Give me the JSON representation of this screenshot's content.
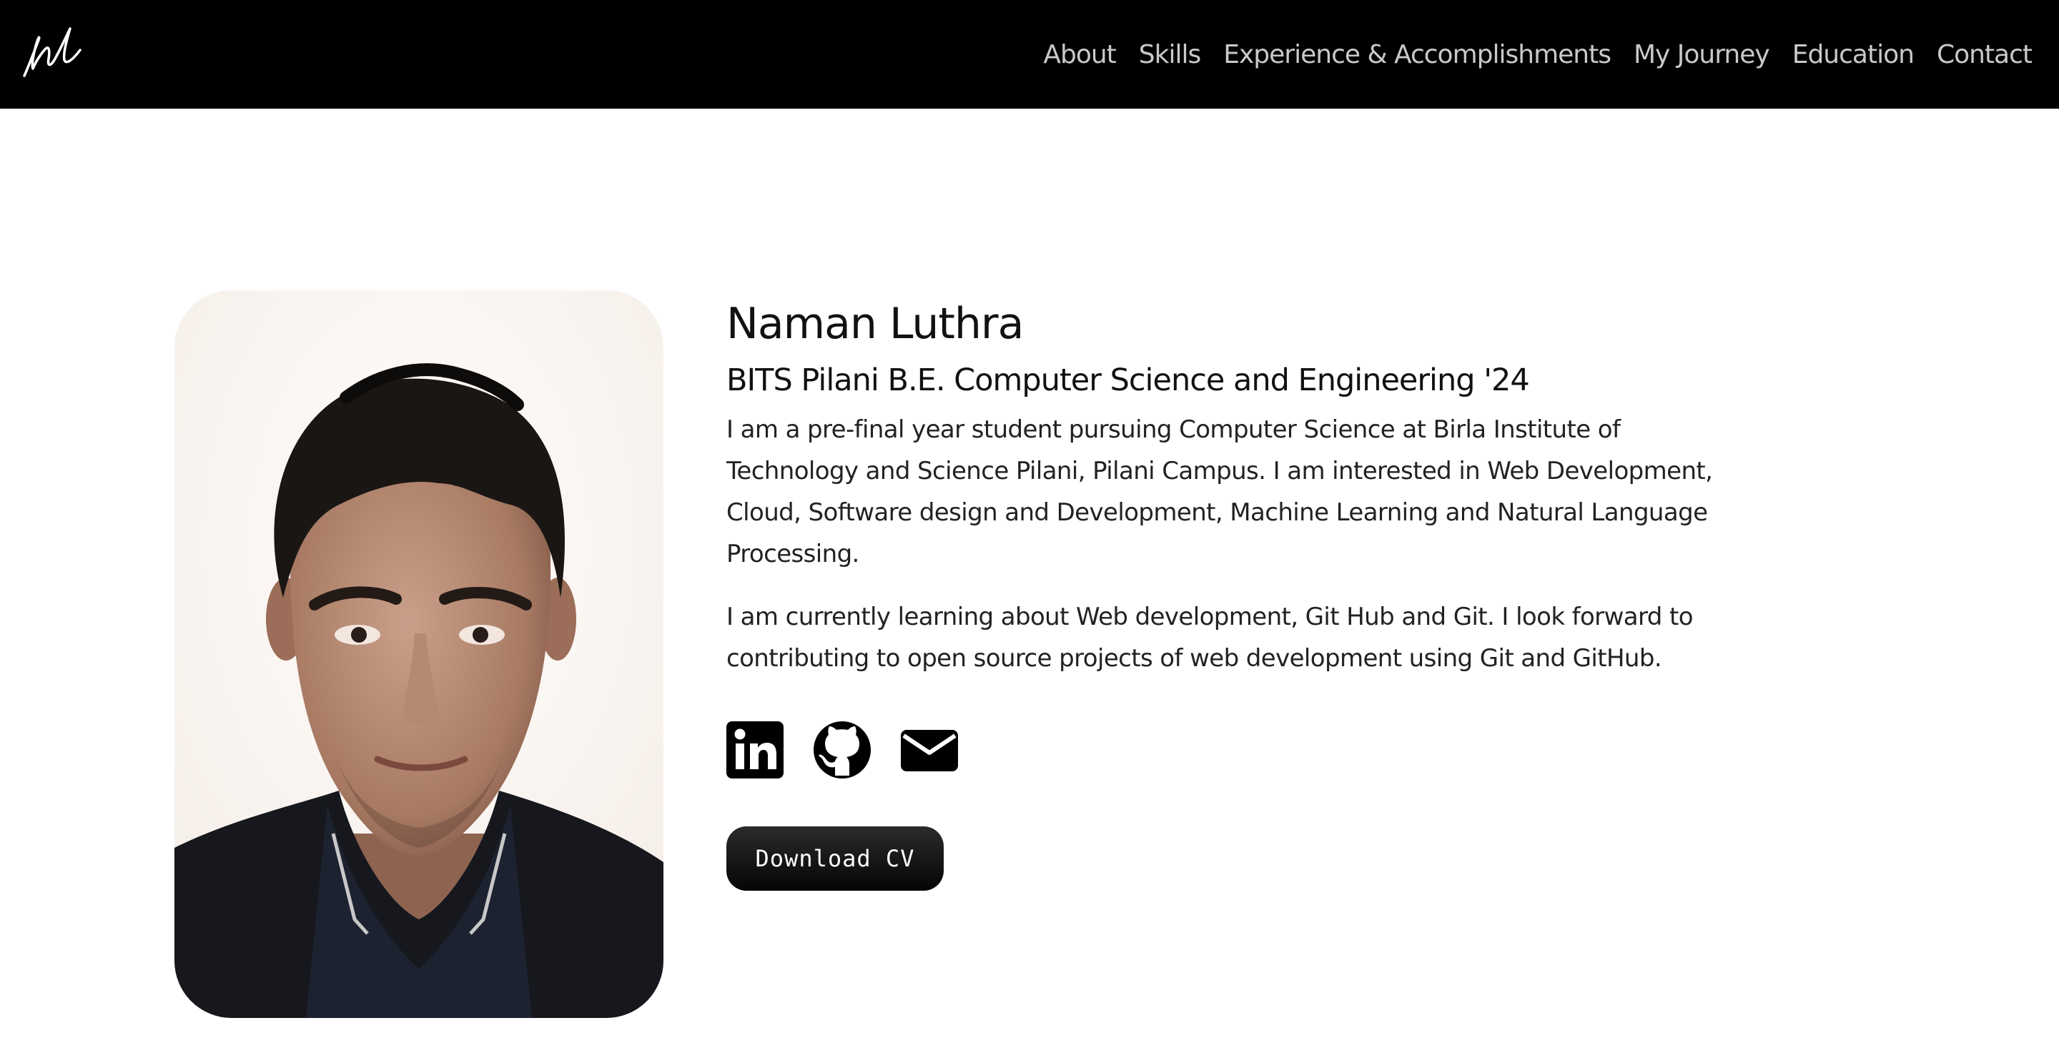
{
  "nav": {
    "links": [
      "About",
      "Skills",
      "Experience & Accomplishments",
      "My Journey",
      "Education",
      "Contact"
    ]
  },
  "profile": {
    "name": "Naman Luthra",
    "subtitle": "BITS Pilani B.E. Computer Science and Engineering '24",
    "paragraphs": [
      "I am a pre-final year student pursuing Computer Science at Birla Institute of Technology and Science Pilani, Pilani Campus. I am interested in Web Development, Cloud, Software design and Development, Machine Learning and Natural Language Processing.",
      "I am currently learning about Web development, Git Hub and Git. I look forward to contributing to open source projects of web development using Git and GitHub."
    ],
    "cv_button_label": "Download CV"
  },
  "socials": [
    {
      "icon": "linkedin-icon"
    },
    {
      "icon": "github-icon"
    },
    {
      "icon": "email-icon"
    }
  ],
  "colors": {
    "navbar_bg": "#000000",
    "nav_text": "#c9c9c9",
    "page_bg": "#ffffff",
    "text": "#111111",
    "button_bg": "#111111",
    "button_text": "#ffffff"
  }
}
